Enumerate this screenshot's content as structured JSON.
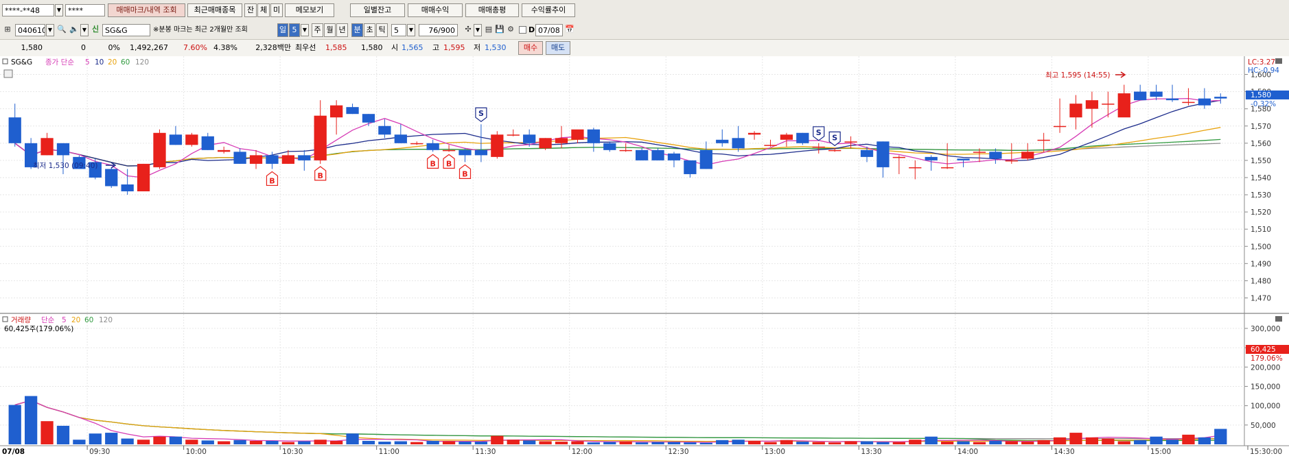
{
  "toolbar1": {
    "account_value": "****-**48",
    "password_value": "****",
    "buttons": [
      "매매마크/내역 조회",
      "최근매매종목",
      "잔",
      "체",
      "미",
      "메모보기",
      "일별잔고",
      "매매수익",
      "매매총평",
      "수익률추이"
    ]
  },
  "toolbar2": {
    "stock_code": "040610",
    "stock_name": "SG&G",
    "notice": "※분봉 마크는 최근 2개월만 조회",
    "periods": [
      "일",
      "5",
      "주",
      "월",
      "년",
      "분",
      "초",
      "틱",
      "5"
    ],
    "count": "76/900",
    "date": "07/08"
  },
  "quote": {
    "price": "1,580",
    "change": "0",
    "change_pct": "0%",
    "volume": "1,492,267",
    "turnover": "7.60%",
    "ratio": "4.38%",
    "amount": "2,328백만",
    "best_label": "최우선",
    "best_ask": "1,585",
    "best_bid": "1,580",
    "open_label": "시",
    "open": "1,565",
    "high_label": "고",
    "high": "1,595",
    "low_label": "저",
    "low": "1,530",
    "buy_label": "매수",
    "sell_label": "매도"
  },
  "price_panel": {
    "title": "SG&G",
    "legend_label": "종가 단순",
    "ma_periods": [
      "5",
      "10",
      "20",
      "60",
      "120"
    ],
    "lc": "LC:3.27",
    "hc": "HC:-0.94",
    "current_tag": "1,580",
    "current_pct": "-0.32%",
    "high_note": "최고 1,595 (14:55)",
    "low_note": "최저 1,530 (09:40)",
    "y_ticks": [
      "1,600",
      "1,590",
      "1,580",
      "1,570",
      "1,560",
      "1,550",
      "1,540",
      "1,530",
      "1,520",
      "1,510",
      "1,500",
      "1,490",
      "1,480",
      "1,470"
    ]
  },
  "volume_panel": {
    "legend_label": "거래량",
    "ma_label": "단순",
    "ma_periods": [
      "5",
      "20",
      "60",
      "120"
    ],
    "current_note": "60,425주(179.06%)",
    "current_tag": "60,425",
    "current_pct": "179.06%",
    "y_ticks": [
      "300,000",
      "250,000",
      "200,000",
      "150,000",
      "100,000",
      "50,000"
    ]
  },
  "x_axis": {
    "date": "07/08",
    "labels": [
      "09:30",
      "10:00",
      "10:30",
      "11:00",
      "11:30",
      "12:00",
      "12:30",
      "13:00",
      "13:30",
      "14:00",
      "14:30",
      "15:00",
      "15:30:00"
    ]
  },
  "colors": {
    "up": "#e8211b",
    "down": "#1f5fcf",
    "ma5": "#d63bb5",
    "ma10": "#1a2a8a",
    "ma20": "#e8a20c",
    "ma60": "#2f9a3e",
    "ma120": "#8d8d8d"
  },
  "chart_data": {
    "type": "candlestick",
    "interval": "5분",
    "x": [
      "09:05",
      "09:10",
      "09:15",
      "09:20",
      "09:25",
      "09:30",
      "09:35",
      "09:40",
      "09:45",
      "09:50",
      "09:55",
      "10:00",
      "10:05",
      "10:10",
      "10:15",
      "10:20",
      "10:25",
      "10:30",
      "10:35",
      "10:40",
      "10:45",
      "10:50",
      "10:55",
      "11:00",
      "11:05",
      "11:10",
      "11:15",
      "11:20",
      "11:25",
      "11:30",
      "11:35",
      "11:40",
      "11:45",
      "11:50",
      "11:55",
      "12:00",
      "12:05",
      "12:10",
      "12:15",
      "12:20",
      "12:25",
      "12:30",
      "12:35",
      "12:40",
      "12:45",
      "12:50",
      "12:55",
      "13:00",
      "13:05",
      "13:10",
      "13:15",
      "13:20",
      "13:25",
      "13:30",
      "13:35",
      "13:40",
      "13:45",
      "13:50",
      "13:55",
      "14:00",
      "14:05",
      "14:10",
      "14:15",
      "14:20",
      "14:25",
      "14:30",
      "14:35",
      "14:40",
      "14:45",
      "14:50",
      "14:55",
      "15:00",
      "15:05",
      "15:10",
      "15:15",
      "15:20"
    ],
    "open": [
      1575,
      1560,
      1553,
      1560,
      1552,
      1549,
      1545,
      1536,
      1532,
      1546,
      1565,
      1559,
      1564,
      1555,
      1555,
      1548,
      1553,
      1548,
      1553,
      1550,
      1575,
      1581,
      1577,
      1570,
      1565,
      1560,
      1560,
      1556,
      1556,
      1556,
      1552,
      1565,
      1565,
      1557,
      1560,
      1562,
      1568,
      1560,
      1556,
      1556,
      1556,
      1554,
      1550,
      1556,
      1562,
      1563,
      1565,
      1559,
      1562,
      1566,
      1558,
      1556,
      1561,
      1556,
      1561,
      1552,
      1546,
      1552,
      1546,
      1551,
      1555,
      1555,
      1550,
      1551,
      1562,
      1570,
      1575,
      1580,
      1583,
      1575,
      1590,
      1590,
      1586,
      1584,
      1586,
      1587
    ],
    "close": [
      1560,
      1546,
      1563,
      1553,
      1545,
      1540,
      1535,
      1532,
      1548,
      1566,
      1559,
      1565,
      1556,
      1556,
      1548,
      1553,
      1548,
      1553,
      1550,
      1576,
      1582,
      1577,
      1572,
      1565,
      1560,
      1560,
      1556,
      1556,
      1553,
      1553,
      1565,
      1565,
      1560,
      1563,
      1563,
      1568,
      1560,
      1556,
      1556,
      1550,
      1550,
      1550,
      1542,
      1545,
      1560,
      1557,
      1566,
      1559,
      1565,
      1560,
      1558,
      1556,
      1561,
      1552,
      1546,
      1552,
      1546,
      1550,
      1546,
      1550,
      1555,
      1551,
      1550,
      1555,
      1562,
      1570,
      1583,
      1585,
      1583,
      1589,
      1585,
      1587,
      1585,
      1584,
      1582,
      1586
    ],
    "high": [
      1583,
      1563,
      1566,
      1560,
      1553,
      1551,
      1546,
      1545,
      1548,
      1568,
      1570,
      1566,
      1566,
      1558,
      1557,
      1556,
      1555,
      1556,
      1556,
      1585,
      1585,
      1583,
      1577,
      1574,
      1571,
      1561,
      1562,
      1559,
      1557,
      1571,
      1567,
      1568,
      1568,
      1563,
      1570,
      1567,
      1569,
      1561,
      1560,
      1557,
      1557,
      1555,
      1550,
      1561,
      1568,
      1570,
      1567,
      1562,
      1566,
      1566,
      1560,
      1557,
      1564,
      1558,
      1561,
      1553,
      1550,
      1553,
      1560,
      1550,
      1557,
      1557,
      1560,
      1560,
      1566,
      1586,
      1588,
      1590,
      1590,
      1594,
      1594,
      1594,
      1594,
      1592,
      1592,
      1589
    ],
    "low": [
      1558,
      1545,
      1553,
      1542,
      1545,
      1539,
      1534,
      1530,
      1532,
      1545,
      1559,
      1558,
      1556,
      1554,
      1548,
      1545,
      1545,
      1548,
      1544,
      1548,
      1565,
      1577,
      1570,
      1563,
      1560,
      1559,
      1555,
      1555,
      1549,
      1549,
      1551,
      1564,
      1558,
      1556,
      1557,
      1560,
      1555,
      1555,
      1555,
      1550,
      1550,
      1546,
      1540,
      1545,
      1558,
      1555,
      1562,
      1558,
      1558,
      1559,
      1554,
      1555,
      1557,
      1549,
      1540,
      1542,
      1539,
      1544,
      1545,
      1546,
      1549,
      1548,
      1548,
      1550,
      1555,
      1566,
      1568,
      1569,
      1575,
      1585,
      1585,
      1585,
      1584,
      1582,
      1580,
      1583
    ],
    "volume": [
      102000,
      125000,
      60000,
      48000,
      12000,
      28000,
      30000,
      15000,
      12000,
      20000,
      20000,
      12000,
      10000,
      8000,
      11000,
      9000,
      9000,
      6000,
      8000,
      12000,
      9000,
      28000,
      9000,
      7000,
      8000,
      6000,
      9000,
      8000,
      7000,
      7000,
      22000,
      12000,
      10000,
      8000,
      7000,
      8000,
      5000,
      6000,
      8000,
      5000,
      6000,
      6000,
      5000,
      4000,
      11000,
      12000,
      9000,
      6000,
      11000,
      7000,
      6000,
      5000,
      8000,
      8000,
      6000,
      6000,
      12000,
      20000,
      7000,
      8000,
      6000,
      9000,
      8000,
      7000,
      11000,
      18000,
      30000,
      18000,
      15000,
      8000,
      11000,
      20000,
      12000,
      25000,
      18000,
      40000
    ],
    "ylim": [
      1465,
      1605
    ],
    "volume_ylim": [
      0,
      330000
    ],
    "annotations": [
      {
        "time": "10:25",
        "mark": "B"
      },
      {
        "time": "10:40",
        "mark": "B"
      },
      {
        "time": "11:15",
        "mark": "B"
      },
      {
        "time": "11:20",
        "mark": "B"
      },
      {
        "time": "11:25",
        "mark": "B"
      },
      {
        "time": "11:30",
        "mark": "S"
      },
      {
        "time": "13:15",
        "mark": "S"
      },
      {
        "time": "13:20",
        "mark": "S"
      }
    ]
  }
}
